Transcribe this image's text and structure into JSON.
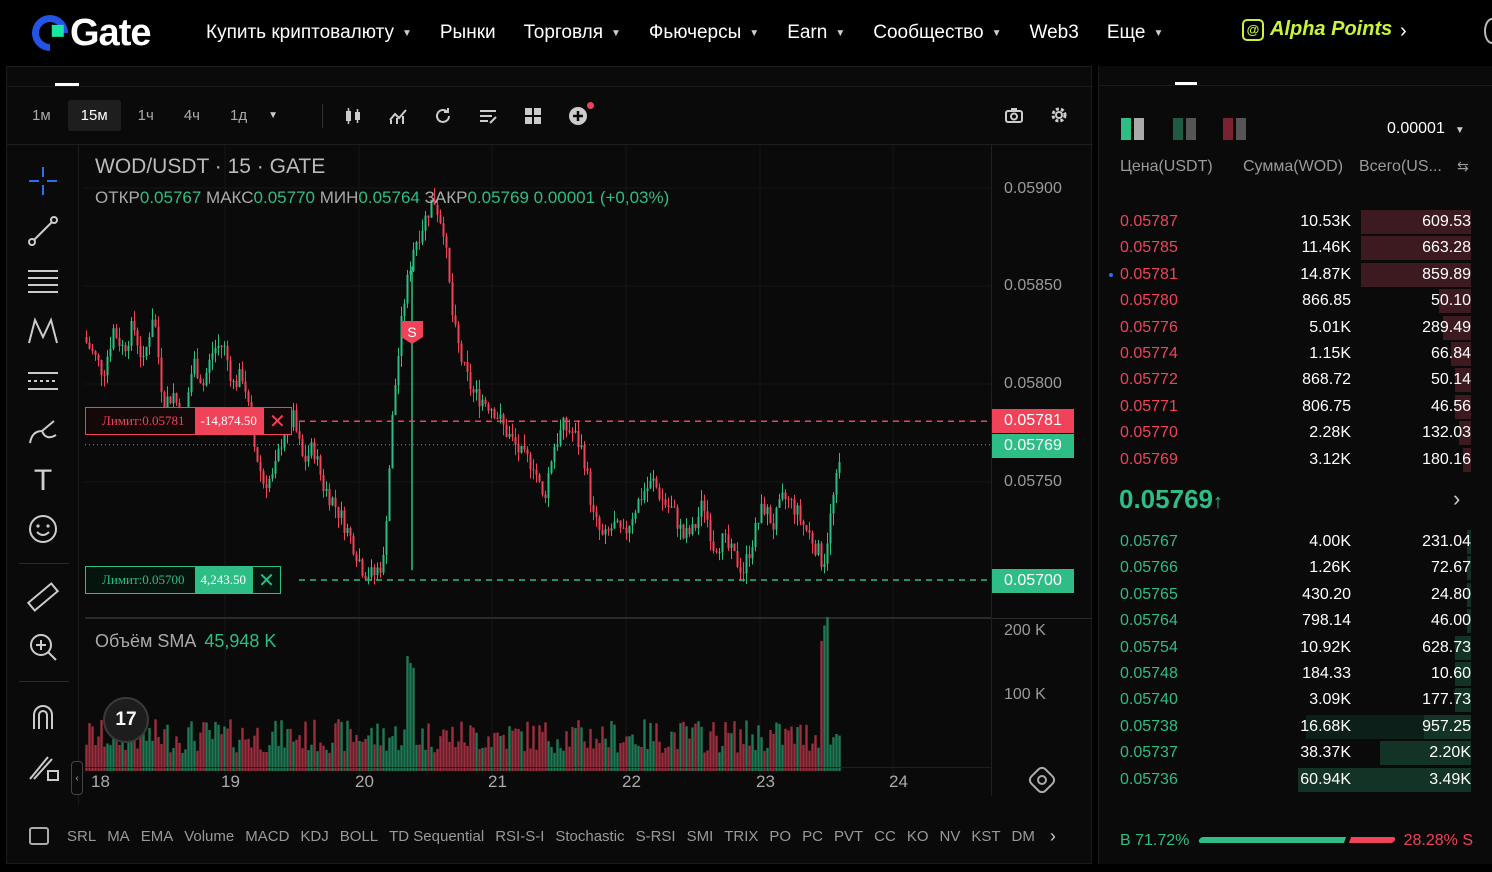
{
  "nav": {
    "logo": "Gate",
    "items": [
      {
        "label": "Купить криптовалюту",
        "caret": true
      },
      {
        "label": "Рынки",
        "caret": false
      },
      {
        "label": "Торговля",
        "caret": true
      },
      {
        "label": "Фьючерсы",
        "caret": true
      },
      {
        "label": "Earn",
        "caret": true
      },
      {
        "label": "Сообщество",
        "caret": true
      },
      {
        "label": "Web3",
        "caret": false
      },
      {
        "label": "Еще",
        "caret": true
      }
    ],
    "alpha_points": "Alpha Points"
  },
  "toolbar": {
    "timeframes": [
      "1м",
      "15м",
      "1ч",
      "4ч",
      "1д"
    ],
    "active_timeframe": "15м"
  },
  "legend": {
    "title": "WOD/USDT · 15 · GATE",
    "open_label": "ОТКР",
    "open": "0.05767",
    "high_label": "МАКС",
    "high": "0.05770",
    "low_label": "МИН",
    "low": "0.05764",
    "close_label": "ЗАКР",
    "close": "0.05769",
    "change": "0.00001 (+0,03%)"
  },
  "orders": {
    "sell": {
      "label": "Лимит:0.05781",
      "qty": "-14,874.50"
    },
    "buy": {
      "label": "Лимит:0.05700",
      "qty": "4,243.50"
    }
  },
  "signal": "S",
  "price_axis": {
    "ticks": [
      "0.05900",
      "0.05850",
      "0.05800",
      "0.05750"
    ],
    "sell_tag": "0.05781",
    "last_tag": "0.05769",
    "buy_tag": "0.05700"
  },
  "volume": {
    "title": "Объём SMA",
    "value": "45,948 K",
    "ticks": [
      "200 K",
      "100 K"
    ]
  },
  "tv_logo": "17",
  "time_axis": [
    "18",
    "19",
    "20",
    "21",
    "22",
    "23",
    "24"
  ],
  "indicators": [
    "SRL",
    "MA",
    "EMA",
    "Volume",
    "MACD",
    "KDJ",
    "BOLL",
    "TD Sequential",
    "RSI-S-I",
    "Stochastic",
    "S-RSI",
    "SMI",
    "TRIX",
    "PO",
    "PC",
    "PVT",
    "CC",
    "KO",
    "NV",
    "KST",
    "DM"
  ],
  "orderbook": {
    "precision": "0.00001",
    "headers": {
      "price": "Цена(USDT)",
      "amount": "Сумма(WOD)",
      "total": "Всего(US..."
    },
    "asks": [
      {
        "price": "0.05787",
        "amount": "10.53K",
        "total": "609.53",
        "depth": 0.28
      },
      {
        "price": "0.05785",
        "amount": "11.46K",
        "total": "663.28",
        "depth": 0.28
      },
      {
        "price": "0.05781",
        "amount": "14.87K",
        "total": "859.89",
        "depth": 0.28
      },
      {
        "price": "0.05780",
        "amount": "866.85",
        "total": "50.10",
        "depth": 0.08
      },
      {
        "price": "0.05776",
        "amount": "5.01K",
        "total": "289.49",
        "depth": 0.07
      },
      {
        "price": "0.05774",
        "amount": "1.15K",
        "total": "66.84",
        "depth": 0.05
      },
      {
        "price": "0.05772",
        "amount": "868.72",
        "total": "50.14",
        "depth": 0.04
      },
      {
        "price": "0.05771",
        "amount": "806.75",
        "total": "46.56",
        "depth": 0.04
      },
      {
        "price": "0.05770",
        "amount": "2.28K",
        "total": "132.03",
        "depth": 0.03
      },
      {
        "price": "0.05769",
        "amount": "3.12K",
        "total": "180.16",
        "depth": 0.02
      }
    ],
    "last_price": "0.05769",
    "last_arrow": "↑",
    "bids": [
      {
        "price": "0.05767",
        "amount": "4.00K",
        "total": "231.04",
        "depth": 0.01,
        "depth2": 0
      },
      {
        "price": "0.05766",
        "amount": "1.26K",
        "total": "72.67",
        "depth": 0.01,
        "depth2": 0
      },
      {
        "price": "0.05765",
        "amount": "430.20",
        "total": "24.80",
        "depth": 0.01,
        "depth2": 0
      },
      {
        "price": "0.05764",
        "amount": "798.14",
        "total": "46.00",
        "depth": 0.01,
        "depth2": 0
      },
      {
        "price": "0.05754",
        "amount": "10.92K",
        "total": "628.73",
        "depth": 0.04,
        "depth2": 0
      },
      {
        "price": "0.05748",
        "amount": "184.33",
        "total": "10.60",
        "depth": 0.04,
        "depth2": 0
      },
      {
        "price": "0.05740",
        "amount": "3.09K",
        "total": "177.73",
        "depth": 0.04,
        "depth2": 0
      },
      {
        "price": "0.05738",
        "amount": "16.68K",
        "total": "957.25",
        "depth": 0.12,
        "depth2": 0.3
      },
      {
        "price": "0.05737",
        "amount": "38.37K",
        "total": "2.20K",
        "depth": 0.23,
        "depth2": 0
      },
      {
        "price": "0.05736",
        "amount": "60.94K",
        "total": "3.49K",
        "depth": 0.44,
        "depth2": 0
      }
    ],
    "buy_ratio": "В 71.72%",
    "sell_ratio": "28.28% S"
  }
}
